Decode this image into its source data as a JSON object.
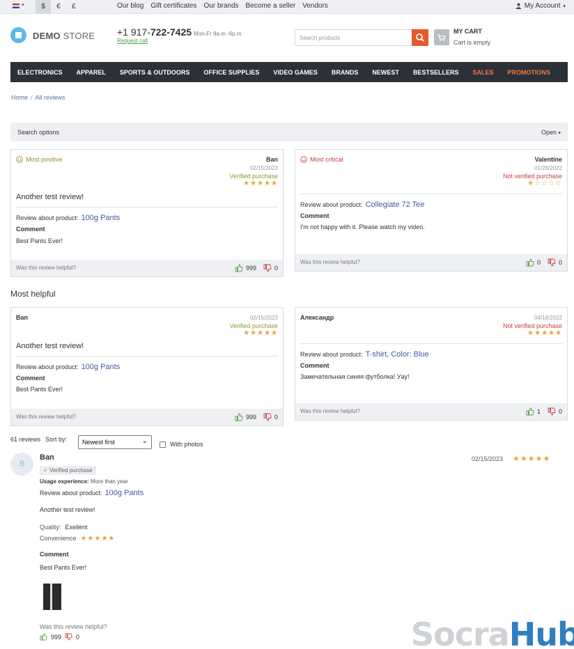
{
  "topbar": {
    "currencies": [
      "$",
      "€",
      "£"
    ],
    "links": [
      "Our blog",
      "Gift certificates",
      "Our brands",
      "Become a seller",
      "Vendors"
    ],
    "account": "My Account"
  },
  "header": {
    "logo_bold": "DEMO",
    "logo_light": "STORE",
    "phone_prefix": "+1 917-",
    "phone_main": "722-7425",
    "phone_hours": "Mon-Fr 9a.m.-6p.m.",
    "request_call": "Request call",
    "search_placeholder": "Search products",
    "cart_title": "MY CART",
    "cart_status": "Cart is empty"
  },
  "nav": [
    {
      "label": "ELECTRONICS",
      "highlight": false
    },
    {
      "label": "APPAREL",
      "highlight": false
    },
    {
      "label": "SPORTS & OUTDOORS",
      "highlight": false
    },
    {
      "label": "OFFICE SUPPLIES",
      "highlight": false
    },
    {
      "label": "VIDEO GAMES",
      "highlight": false
    },
    {
      "label": "BRANDS",
      "highlight": false
    },
    {
      "label": "NEWEST",
      "highlight": false
    },
    {
      "label": "BESTSELLERS",
      "highlight": false
    },
    {
      "label": "SALES",
      "highlight": true
    },
    {
      "label": "PROMOTIONS",
      "highlight": true
    }
  ],
  "breadcrumb": {
    "home": "Home",
    "separator": "/",
    "current": "All reviews"
  },
  "search_options": {
    "label": "Search options",
    "toggle": "Open"
  },
  "labels": {
    "review_about": "Review about product:",
    "comment": "Comment",
    "helpful_question": "Was this review helpful?",
    "most_helpful": "Most helpful",
    "sort_by": "Sort by:",
    "with_photos": "With photos",
    "usage_experience": "Usage experience:",
    "quality": "Quality:",
    "convenience": "Convenience"
  },
  "cards": {
    "positive": {
      "title": "Most positive",
      "author": "Ban",
      "date": "02/15/2023",
      "purchase": "Verified purchase",
      "rating": 5,
      "text": "Another test review!",
      "product": "100g Pants",
      "comment": "Best Pants Ever!",
      "likes": "999",
      "dislikes": "0"
    },
    "critical": {
      "title": "Most critical",
      "author": "Valentine",
      "date": "01/28/2022",
      "purchase": "Not verified purchase",
      "rating": 1,
      "product": "Collegiate 72 Tee",
      "comment": "I'm not happy with it. Please watch my video.",
      "likes": "0",
      "dislikes": "0"
    },
    "helpful1": {
      "author": "Ban",
      "date": "02/15/2023",
      "purchase": "Verified purchase",
      "rating": 5,
      "text": "Another test review!",
      "product": "100g Pants",
      "comment": "Best Pants Ever!",
      "likes": "999",
      "dislikes": "0"
    },
    "helpful2": {
      "author": "Александр",
      "date": "04/18/2022",
      "purchase": "Not verified purchase",
      "rating": 5,
      "product": "T-shirt, Color: Blue",
      "comment": "Замечательная синяя футболка! Уау!",
      "likes": "1",
      "dislikes": "0"
    }
  },
  "list": {
    "count": "61 reviews",
    "sort_value": "Newest first",
    "review": {
      "avatar": "B",
      "author": "Ban",
      "badge": "Verified purchase",
      "date": "02/15/2023",
      "rating": 5,
      "usage": "More than year",
      "product": "100g Pants",
      "text": "Another test review!",
      "quality": "Exellent",
      "convenience_rating": 5,
      "comment": "Best Pants Ever!",
      "likes": "999",
      "dislikes": "0"
    }
  },
  "watermark": {
    "part1": "Socra",
    "part2": "Hub"
  },
  "colors": {
    "nav_bg": "#2c3039",
    "accent_orange": "#f07a3a",
    "search_btn": "#e8582d",
    "link_blue": "#3f5a9e",
    "star": "#e8a43a"
  }
}
